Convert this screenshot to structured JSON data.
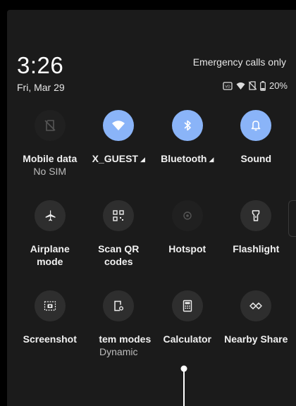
{
  "header": {
    "time": "3:26",
    "date": "Fri, Mar 29",
    "emergency": "Emergency calls only",
    "battery": "20%"
  },
  "tiles": [
    {
      "label": "Mobile data",
      "sub": "No SIM",
      "icon": "no-sim-icon",
      "state": "off"
    },
    {
      "label": "X_GUEST",
      "sub": "",
      "icon": "wifi-icon",
      "state": "on"
    },
    {
      "label": "Bluetooth",
      "sub": "",
      "icon": "bluetooth-icon",
      "state": "on"
    },
    {
      "label": "Sound",
      "sub": "",
      "icon": "bell-icon",
      "state": "on"
    },
    {
      "label": "Airplane",
      "sub": "mode",
      "icon": "airplane-icon",
      "state": "inactive"
    },
    {
      "label": "Scan QR",
      "sub": "codes",
      "icon": "qr-code-icon",
      "state": "inactive"
    },
    {
      "label": "Hotspot",
      "sub": "",
      "icon": "hotspot-icon",
      "state": "off"
    },
    {
      "label": "Flashlight",
      "sub": "",
      "icon": "flashlight-icon",
      "state": "inactive"
    },
    {
      "label": "Screenshot",
      "sub": "",
      "icon": "screenshot-icon",
      "state": "inactive"
    },
    {
      "label": "tem modes",
      "sub": "Dynamic",
      "icon": "system-modes-icon",
      "state": "inactive"
    },
    {
      "label": "Calculator",
      "sub": "",
      "icon": "calculator-icon",
      "state": "inactive"
    },
    {
      "label": "Nearby Share",
      "sub": "",
      "icon": "nearby-share-icon",
      "state": "inactive"
    }
  ],
  "colors": {
    "active_tile": "#8ab4f8",
    "inactive_tile": "#2e2e2e",
    "panel_bg": "#1b1b1b"
  }
}
